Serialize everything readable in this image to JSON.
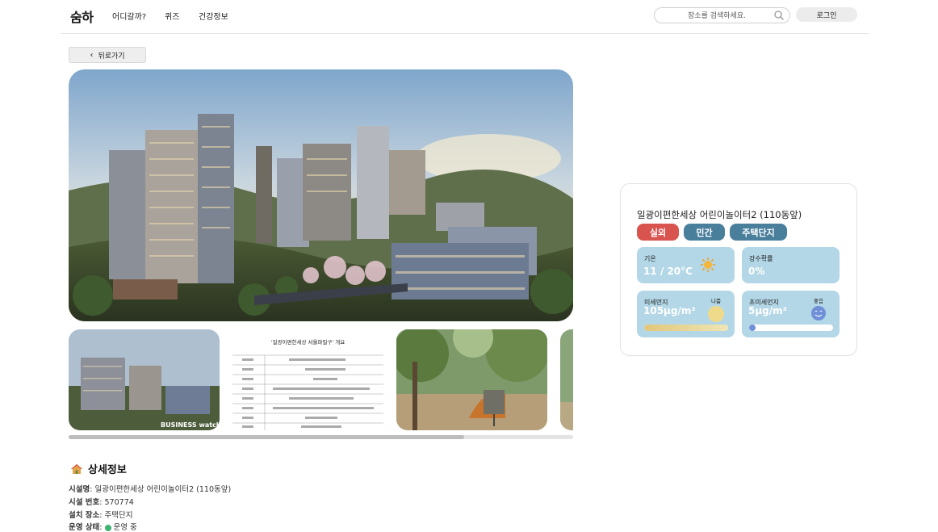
{
  "header": {
    "logo": "숨하",
    "nav": [
      "어디갈까?",
      "퀴즈",
      "건강정보"
    ],
    "search_placeholder": "장소를 검색하세요.",
    "login_label": "로그인"
  },
  "back_label": "뒤로가기",
  "gallery": {
    "hero_caption": "",
    "thumbnails": [
      {
        "name": "apartment-render",
        "watermark": "BUSINESS watch"
      },
      {
        "name": "document-table",
        "title": "'일광이편한세상 서울파밀구' 개요"
      },
      {
        "name": "playground-photo"
      },
      {
        "name": "partial-photo"
      }
    ],
    "scroll_position_fraction": 0.78
  },
  "details": {
    "heading": "상세정보",
    "rows": [
      {
        "key": "시설명",
        "value": "일광이편한세상 어린이놀이터2 (110동앞)"
      },
      {
        "key": "시설 번호",
        "value": "570774"
      },
      {
        "key": "설치 장소",
        "value": "주택단지"
      },
      {
        "key": "운영 상태",
        "value": "운영 중"
      }
    ]
  },
  "info_card": {
    "title": "일광이편한세상 어린이놀이터2 (110동앞)",
    "tags": [
      {
        "label": "실외",
        "color": "#d9534f"
      },
      {
        "label": "민간",
        "color": "#4a7f9c"
      },
      {
        "label": "주택단지",
        "color": "#4a7f9c"
      }
    ],
    "temperature": {
      "label": "기온",
      "value": "11 / 20°C",
      "icon": "sun-icon"
    },
    "precipitation": {
      "label": "강수확률",
      "value": "0%"
    },
    "pm10": {
      "label": "미세먼지",
      "value": "105μg/m³",
      "grade": "나쁨",
      "level_fraction": 1.0,
      "icon": "sad-face-icon"
    },
    "pm25": {
      "label": "초미세먼지",
      "value": "5μg/m³",
      "grade": "좋음",
      "level_fraction": 0.08,
      "icon": "smile-face-icon"
    }
  }
}
